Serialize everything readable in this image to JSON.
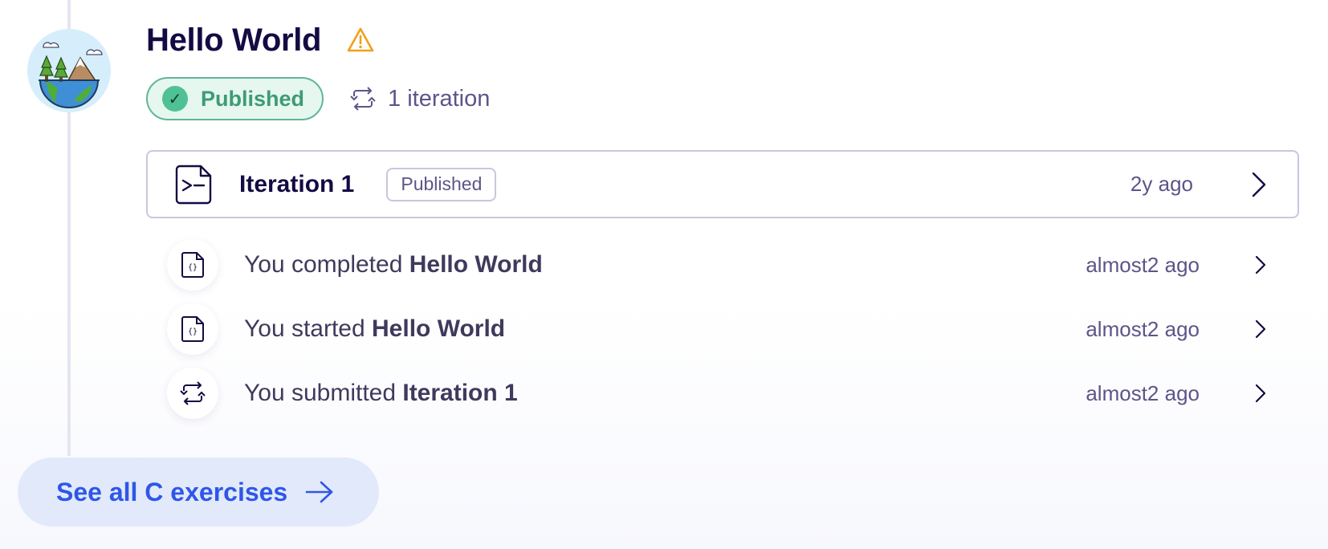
{
  "exercise": {
    "title": "Hello World",
    "status": "Published",
    "iterations_label": "1 iteration"
  },
  "icons": {
    "avatar": "hello-world-globe-icon",
    "warning": "warning-icon",
    "status": "check-icon",
    "iterations": "iteration-cycle-icon"
  },
  "iteration": {
    "title": "Iteration 1",
    "badge": "Published",
    "time": "2y ago"
  },
  "activities": [
    {
      "prefix": "You completed ",
      "subject": "Hello World",
      "time": "almost2 ago",
      "icon": "code-file-icon"
    },
    {
      "prefix": "You started ",
      "subject": "Hello World",
      "time": "almost2 ago",
      "icon": "code-file-icon"
    },
    {
      "prefix": "You submitted ",
      "subject": "Iteration 1",
      "time": "almost2 ago",
      "icon": "iteration-cycle-icon"
    }
  ],
  "footer": {
    "see_all_label": "See all C exercises"
  },
  "colors": {
    "title": "#130b43",
    "published_green": "#3e9b76",
    "published_bg": "#e6f7ef",
    "warning": "#f29f1c",
    "muted": "#5c5589",
    "link_blue": "#2e57e8",
    "link_bg": "#e2e9fb"
  }
}
